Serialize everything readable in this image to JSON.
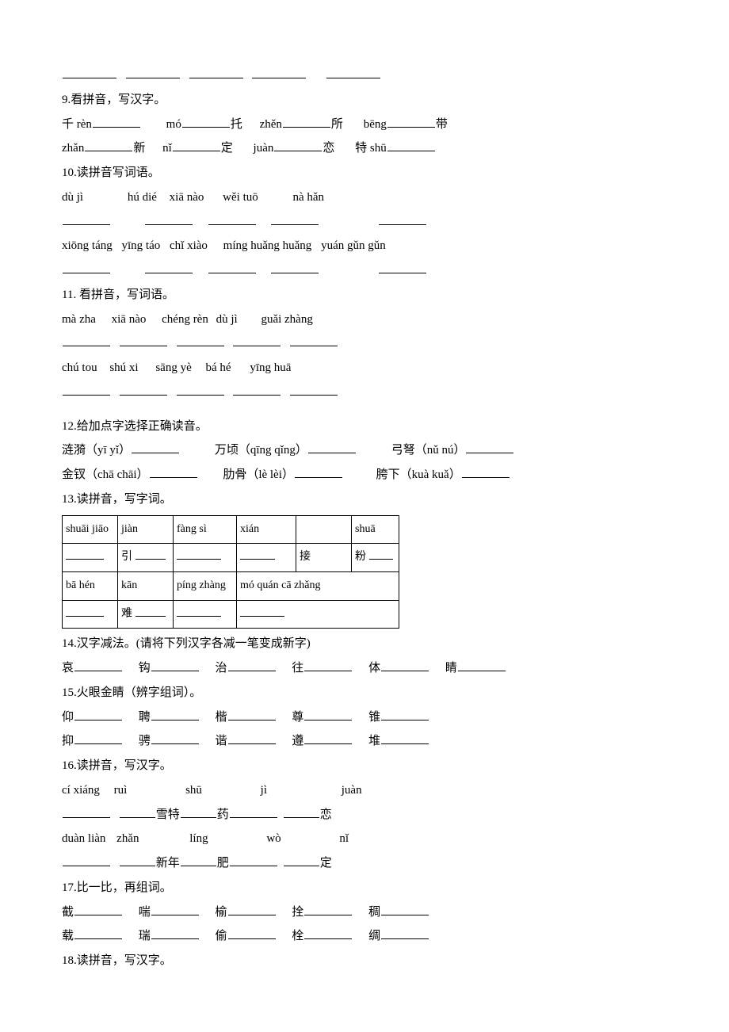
{
  "topblanks_count": 5,
  "q9": {
    "title": "9.看拼音，写汉字。",
    "row1": [
      {
        "pre": "千 rèn",
        "post": ""
      },
      {
        "pre": "mó",
        "post": "托"
      },
      {
        "pre": "zhěn",
        "post": "所"
      },
      {
        "pre": "bēng",
        "post": "带"
      }
    ],
    "row2": [
      {
        "pre": "zhǎn",
        "post": "新"
      },
      {
        "pre": "nǐ",
        "post": "定"
      },
      {
        "pre": "juàn",
        "post": "恋"
      },
      {
        "pre": "特 shū",
        "post": ""
      }
    ]
  },
  "q10": {
    "title": "10.读拼音写词语。",
    "row1": [
      "dù jì",
      "hú      dié",
      "xiā  nào",
      "wěi      tuō",
      "nà  hǎn"
    ],
    "row2": [
      "xiōng      táng",
      "yīng      táo",
      "chǐ      xiào",
      "míng huǎng huǎng",
      "yuán gǔn gǔn"
    ]
  },
  "q11": {
    "title": "11. 看拼音，写词语。",
    "row1": [
      "mà  zha",
      "xiā  nào",
      "chéng  rèn",
      "dù  jì",
      "guǎi  zhàng"
    ],
    "row2": [
      "chú  tou",
      "shú  xi",
      "sāng  yè",
      "bá  hé",
      "yīng  huā"
    ]
  },
  "q12": {
    "title": "12.给加点字选择正确读音。",
    "row1": [
      {
        "label": "涟漪（yī  yǐ）"
      },
      {
        "label": "万顷（qīng qǐng）"
      },
      {
        "label": "弓弩（nǔ  nú）"
      }
    ],
    "row2": [
      {
        "label": "金钗（chā chāi）"
      },
      {
        "label": "肋骨（lè  lèi）"
      },
      {
        "label": "胯下（kuà kuǎ）"
      }
    ]
  },
  "q13": {
    "title": "13.读拼音，写字词。",
    "r1": [
      "shuāi jiāo",
      "jiàn",
      "fàng sì",
      "xián",
      "",
      "shuā"
    ],
    "r2": [
      "",
      "引",
      "",
      "",
      "接",
      "粉"
    ],
    "r3": [
      "bā hén",
      "kān",
      "píng zhàng",
      "mó quán cā zhǎng"
    ],
    "r4": [
      "",
      "难",
      "",
      ""
    ]
  },
  "q14": {
    "title": "14.汉字减法。(请将下列汉字各减一笔变成新字)",
    "items": [
      "哀",
      "钩",
      "治",
      "往",
      "体",
      "睛"
    ]
  },
  "q15": {
    "title": "15.火眼金睛（辨字组词）。",
    "row1": [
      "仰",
      "聘",
      "楷",
      "尊",
      "锥"
    ],
    "row2": [
      "抑",
      "骋",
      "谐",
      "遵",
      "堆"
    ]
  },
  "q16": {
    "title": "16.读拼音，写汉字。",
    "r1_pinyin": [
      "cí  xiáng",
      "ruì",
      "shū",
      "jì",
      "juàn"
    ],
    "r1_text": [
      "",
      "",
      "雪",
      "特",
      "药",
      "",
      "",
      "恋"
    ],
    "r2_pinyin": [
      "duàn  liàn",
      "zhǎn",
      "líng",
      "wò",
      "nǐ"
    ],
    "r2_text": [
      "",
      "",
      "新",
      "年",
      "肥",
      "",
      "",
      "定"
    ]
  },
  "q17": {
    "title": "17.比一比，再组词。",
    "row1": [
      "截",
      "喘",
      "榆",
      "拴",
      "稠"
    ],
    "row2": [
      "载",
      "瑞",
      "偷",
      "栓",
      "绸"
    ]
  },
  "q18": {
    "title": "18.读拼音，写汉字。"
  }
}
